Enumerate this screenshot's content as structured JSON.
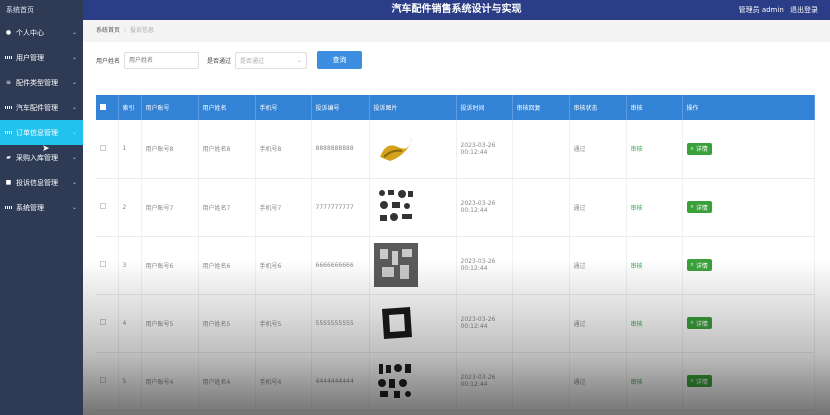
{
  "header": {
    "title": "汽车配件销售系统设计与实现",
    "user": "管理员 admin",
    "logout": "退出登录"
  },
  "sidebar": {
    "home": "系统首页",
    "items": [
      {
        "label": "个人中心",
        "icon": "user-icon"
      },
      {
        "label": "用户管理",
        "icon": "grid-icon"
      },
      {
        "label": "配件类型管理",
        "icon": "list-icon"
      },
      {
        "label": "汽车配件管理",
        "icon": "grid-icon"
      },
      {
        "label": "订单信息管理",
        "icon": "grid-icon"
      },
      {
        "label": "采购入库管理",
        "icon": "truck-icon"
      },
      {
        "label": "投诉信息管理",
        "icon": "chat-icon"
      },
      {
        "label": "系统管理",
        "icon": "grid-icon"
      }
    ]
  },
  "breadcrumb": {
    "home": "系统首页",
    "current": "投诉信息"
  },
  "search": {
    "user_name_label": "用户姓名",
    "user_name_placeholder": "用户姓名",
    "audit_label": "是否通过",
    "audit_placeholder": "是否通过",
    "query_button": "查询"
  },
  "table": {
    "headers": [
      "",
      "索引",
      "用户账号",
      "用户姓名",
      "手机号",
      "投诉编号",
      "投诉图片",
      "投诉时间",
      "审核回复",
      "审核状态",
      "审核",
      "操作"
    ],
    "rows": [
      {
        "index": "1",
        "account": "用户账号8",
        "name": "用户姓名8",
        "phone": "手机号8",
        "code": "8888888888",
        "time": "2023-03-26 00:12:44",
        "reply": "",
        "status": "通过",
        "audit": "审核",
        "action": "详情"
      },
      {
        "index": "2",
        "account": "用户账号7",
        "name": "用户姓名7",
        "phone": "手机号7",
        "code": "7777777777",
        "time": "2023-03-26 00:12:44",
        "reply": "",
        "status": "通过",
        "audit": "审核",
        "action": "详情"
      },
      {
        "index": "3",
        "account": "用户账号6",
        "name": "用户姓名6",
        "phone": "手机号6",
        "code": "6666666666",
        "time": "2023-03-26 00:12:44",
        "reply": "",
        "status": "通过",
        "audit": "审核",
        "action": "详情"
      },
      {
        "index": "4",
        "account": "用户账号5",
        "name": "用户姓名5",
        "phone": "手机号5",
        "code": "5555555555",
        "time": "2023-03-26 00:12:44",
        "reply": "",
        "status": "通过",
        "audit": "审核",
        "action": "详情"
      },
      {
        "index": "5",
        "account": "用户账号4",
        "name": "用户姓名4",
        "phone": "手机号4",
        "code": "4444444444",
        "time": "2023-03-26 00:12:44",
        "reply": "",
        "status": "通过",
        "audit": "审核",
        "action": "详情"
      }
    ]
  }
}
